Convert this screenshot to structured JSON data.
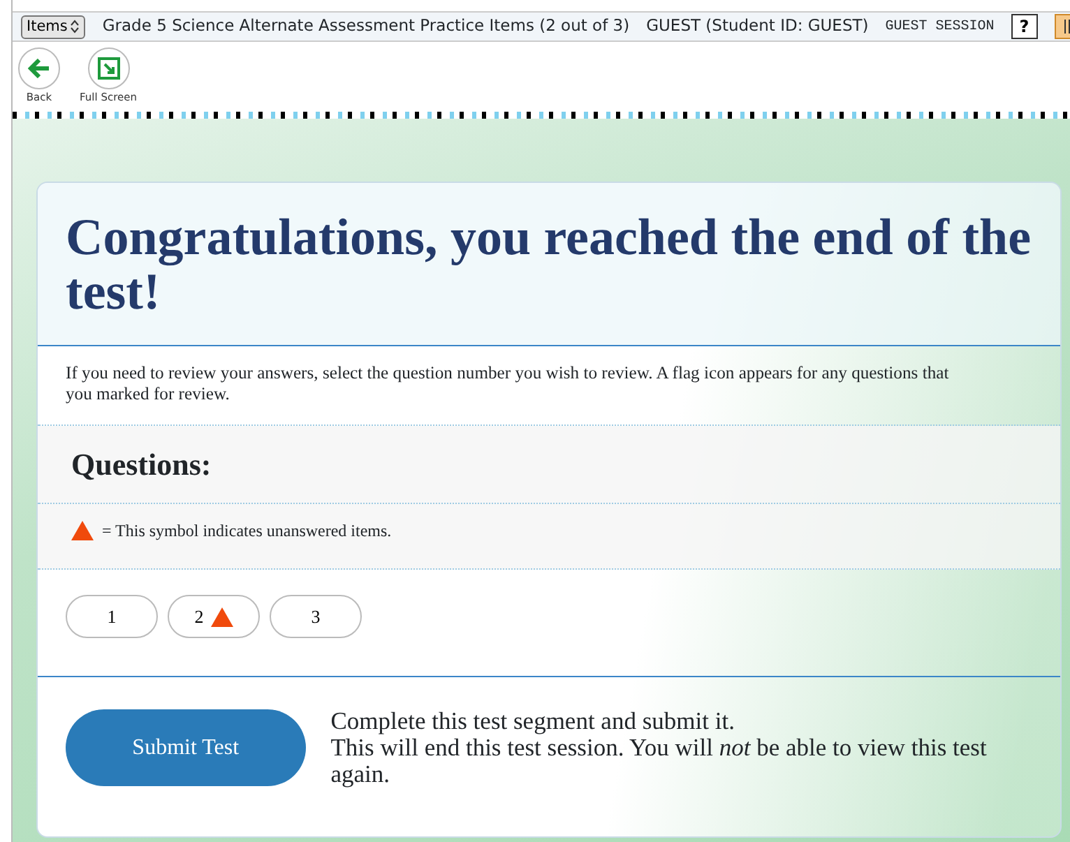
{
  "header": {
    "items_menu": "Items",
    "title": "Grade 5 Science Alternate Assessment Practice Items (2 out of 3)",
    "student": "GUEST (Student ID: GUEST)",
    "session": "GUEST SESSION",
    "help": "?"
  },
  "toolbar": [
    {
      "label": "Back",
      "kind": "back"
    },
    {
      "label": "Full Screen",
      "kind": "fullscreen"
    }
  ],
  "heading": "Congratulations, you reached the end of the test!",
  "instructions": "If you need to review your answers, select the question number you wish to review. A flag icon appears for any questions that you marked for review.",
  "questions_title": "Questions:",
  "legend": "= This symbol indicates unanswered items.",
  "questions": [
    {
      "label": "1",
      "unanswered": false
    },
    {
      "label": "2",
      "unanswered": true
    },
    {
      "label": "3",
      "unanswered": false
    }
  ],
  "submit": {
    "button": "Submit Test",
    "lines": [
      "Complete this test segment and submit it.",
      "This will end this test session. You will *not* be able to view this test again."
    ]
  }
}
